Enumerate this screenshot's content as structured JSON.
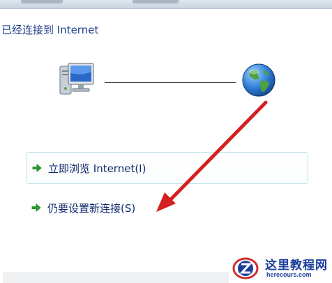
{
  "heading": "已经连接到 Internet",
  "tasks": {
    "browse_label": "立即浏览 Internet(I)",
    "setup_label": "仍要设置新连接(S)"
  },
  "icons": {
    "computer": "computer-icon",
    "internet": "globe-icon",
    "task_arrow": "green-arrow-icon"
  },
  "colors": {
    "heading_text": "#1e3f8a",
    "task_text": "#102a6b",
    "arrow_green": "#2aa02a",
    "annotation_red": "#d42020"
  },
  "watermark": {
    "name": "这里教程网",
    "url": "herecours.com"
  }
}
